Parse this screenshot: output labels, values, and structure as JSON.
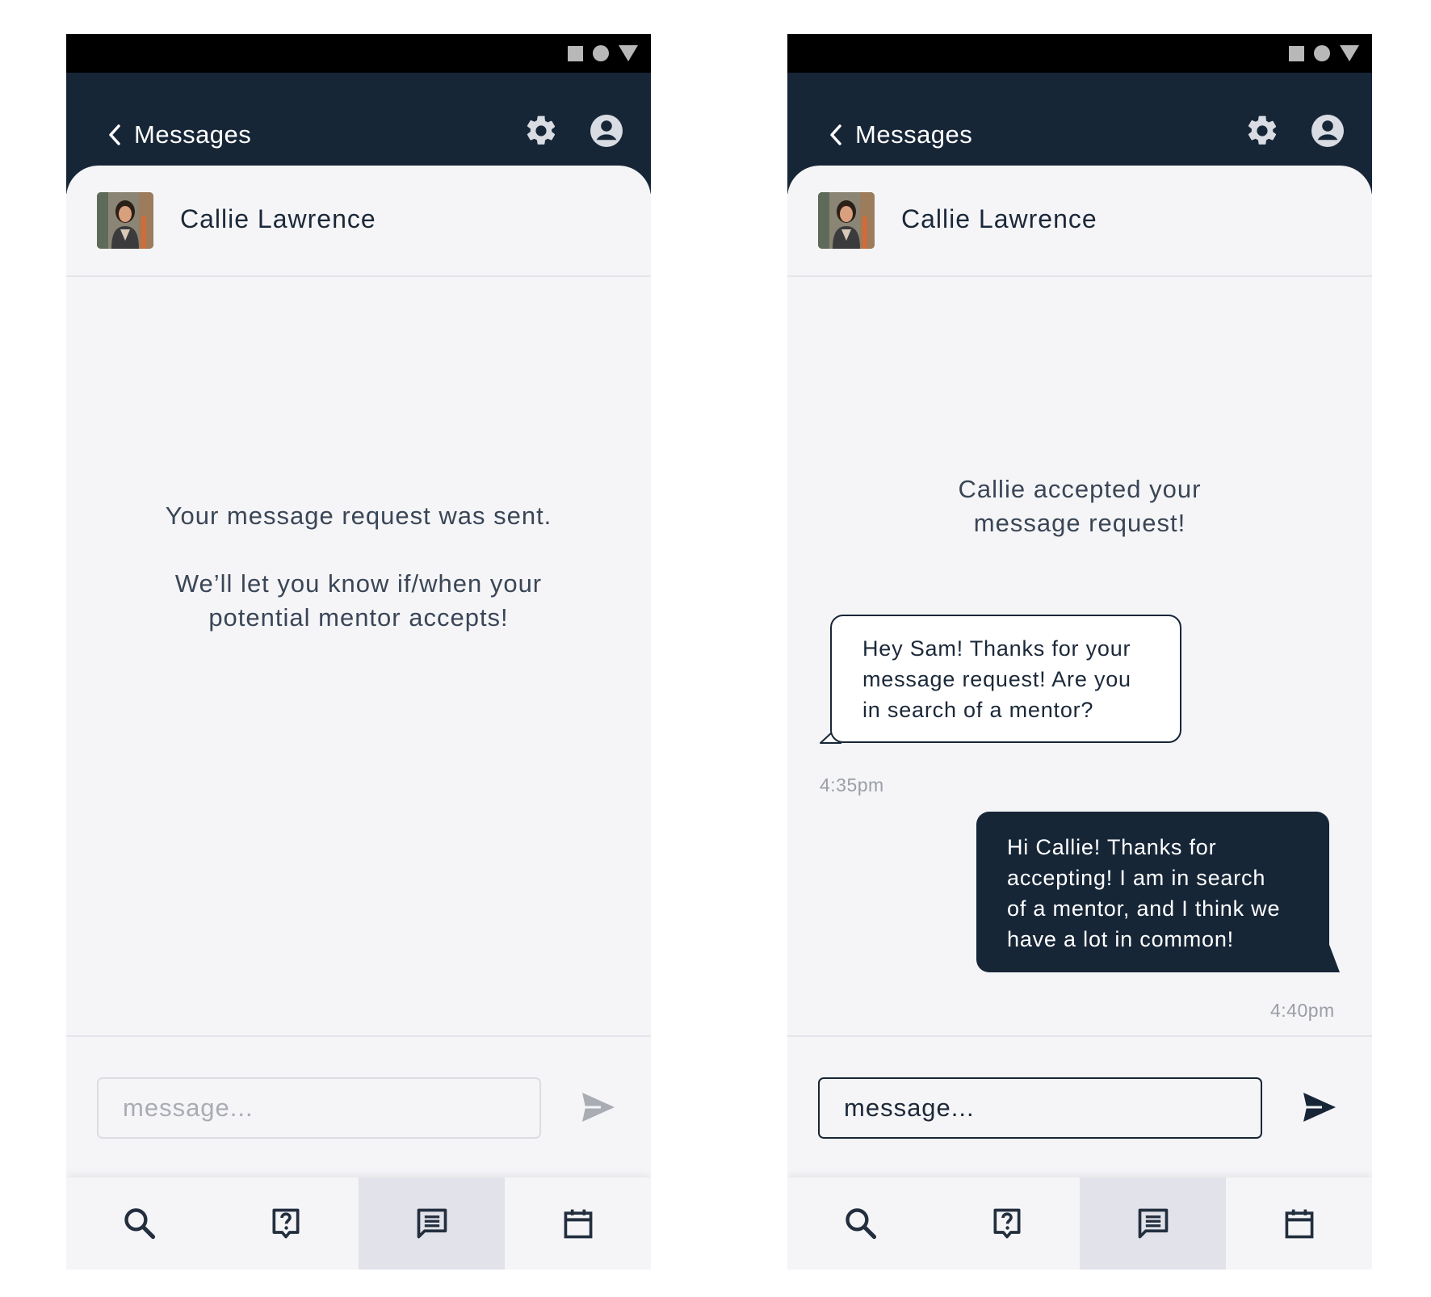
{
  "colors": {
    "header_bg": "#172637",
    "status_bar": "#000000",
    "page_bg": "#f5f5f8",
    "active_tab": "#e2e2ea",
    "timestamp": "#9a9ea6"
  },
  "icons": {
    "status": [
      "square-icon",
      "circle-icon",
      "triangle-icon"
    ],
    "header": [
      "chevron-left-icon",
      "gear-icon",
      "account-circle-icon"
    ],
    "tabs": [
      "search-icon",
      "help-bubble-icon",
      "message-icon",
      "calendar-icon"
    ],
    "composer": [
      "send-icon"
    ]
  },
  "screens": [
    {
      "header": {
        "back_label": "Messages"
      },
      "contact": {
        "name": "Callie Lawrence"
      },
      "notice": {
        "line1": "Your message request was sent.",
        "line2": "We’ll let you know if/when your",
        "line3": "potential mentor accepts!"
      },
      "composer": {
        "placeholder": "message...",
        "send_enabled": false
      },
      "tabs": {
        "active": "messages"
      }
    },
    {
      "header": {
        "back_label": "Messages"
      },
      "contact": {
        "name": "Callie Lawrence"
      },
      "notice": {
        "line1": "Callie accepted your",
        "line2": "message request!"
      },
      "messages": [
        {
          "direction": "incoming",
          "lines": [
            "Hey Sam! Thanks for your",
            "message request! Are you",
            "in search of a mentor?"
          ],
          "time": "4:35pm"
        },
        {
          "direction": "outgoing",
          "lines": [
            "Hi Callie! Thanks for",
            "accepting! I am in search",
            "of a mentor, and I think we",
            "have a lot in common!"
          ],
          "time": "4:40pm"
        }
      ],
      "composer": {
        "placeholder": "message...",
        "send_enabled": true
      },
      "tabs": {
        "active": "messages"
      }
    }
  ]
}
